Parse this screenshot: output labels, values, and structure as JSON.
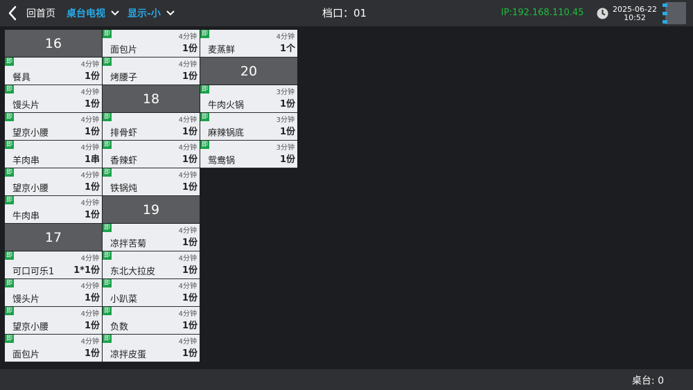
{
  "header": {
    "back_icon": "chevron-left-icon",
    "home_label": "回首页",
    "view_dropdown": "桌台电视",
    "display_dropdown": "显示-小",
    "stall_label": "档口：01",
    "ip": "IP:192.168.110.45",
    "date": "2025-06-22",
    "time": "10:52",
    "colors": {
      "accent": "#29a8e6",
      "ip_green": "#1fbf3c",
      "tag_green": "#1aa24a"
    }
  },
  "footer": {
    "table_count": "桌台: 0"
  },
  "columns": [
    [
      {
        "type": "header",
        "label": "16"
      },
      {
        "type": "item",
        "tag": "即",
        "time": "4分钟",
        "name": "餐具",
        "qty": "1份"
      },
      {
        "type": "item",
        "tag": "即",
        "time": "4分钟",
        "name": "馒头片",
        "qty": "1份"
      },
      {
        "type": "item",
        "tag": "即",
        "time": "4分钟",
        "name": "望京小腰",
        "qty": "1份"
      },
      {
        "type": "item",
        "tag": "即",
        "time": "4分钟",
        "name": "羊肉串",
        "qty": "1串"
      },
      {
        "type": "item",
        "tag": "即",
        "time": "4分钟",
        "name": "望京小腰",
        "qty": "1份"
      },
      {
        "type": "item",
        "tag": "即",
        "time": "4分钟",
        "name": "牛肉串",
        "qty": "1份"
      },
      {
        "type": "header",
        "label": "17"
      },
      {
        "type": "item",
        "tag": "即",
        "time": "4分钟",
        "name": "可口可乐1",
        "qty": "1*1份"
      },
      {
        "type": "item",
        "tag": "即",
        "time": "4分钟",
        "name": "馒头片",
        "qty": "1份"
      },
      {
        "type": "item",
        "tag": "即",
        "time": "4分钟",
        "name": "望京小腰",
        "qty": "1份"
      },
      {
        "type": "item",
        "tag": "即",
        "time": "4分钟",
        "name": "面包片",
        "qty": "1份"
      }
    ],
    [
      {
        "type": "item",
        "tag": "即",
        "time": "4分钟",
        "name": "面包片",
        "qty": "1份"
      },
      {
        "type": "item",
        "tag": "即",
        "time": "4分钟",
        "name": "烤腰子",
        "qty": "1份"
      },
      {
        "type": "header",
        "label": "18"
      },
      {
        "type": "item",
        "tag": "即",
        "time": "4分钟",
        "name": "排骨虾",
        "qty": "1份"
      },
      {
        "type": "item",
        "tag": "即",
        "time": "4分钟",
        "name": "香辣虾",
        "qty": "1份"
      },
      {
        "type": "item",
        "tag": "即",
        "time": "4分钟",
        "name": "铁锅炖",
        "qty": "1份"
      },
      {
        "type": "header",
        "label": "19"
      },
      {
        "type": "item",
        "tag": "即",
        "time": "4分钟",
        "name": "凉拌苦菊",
        "qty": "1份"
      },
      {
        "type": "item",
        "tag": "即",
        "time": "4分钟",
        "name": "东北大拉皮",
        "qty": "1份"
      },
      {
        "type": "item",
        "tag": "即",
        "time": "4分钟",
        "name": "小趴菜",
        "qty": "1份"
      },
      {
        "type": "item",
        "tag": "即",
        "time": "4分钟",
        "name": "负数",
        "qty": "1份"
      },
      {
        "type": "item",
        "tag": "即",
        "time": "4分钟",
        "name": "凉拌皮蛋",
        "qty": "1份"
      }
    ],
    [
      {
        "type": "item",
        "tag": "即",
        "time": "4分钟",
        "name": "麦蒸鲜",
        "qty": "1个"
      },
      {
        "type": "header",
        "label": "20"
      },
      {
        "type": "item",
        "tag": "即",
        "time": "3分钟",
        "name": "牛肉火锅",
        "qty": "1份"
      },
      {
        "type": "item",
        "tag": "即",
        "time": "3分钟",
        "name": "麻辣锅底",
        "qty": "1份"
      },
      {
        "type": "item",
        "tag": "即",
        "time": "3分钟",
        "name": "鸳鸯锅",
        "qty": "1份"
      }
    ]
  ]
}
